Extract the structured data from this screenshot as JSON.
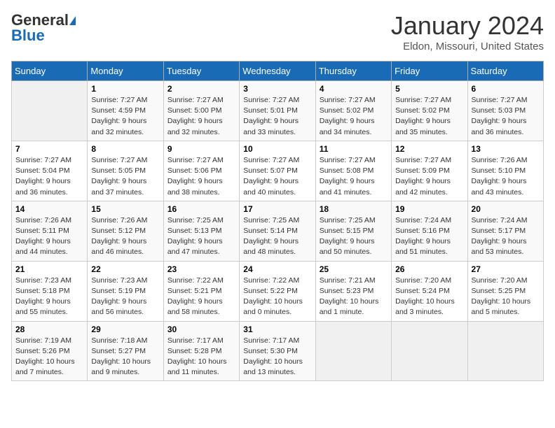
{
  "header": {
    "logo_general": "General",
    "logo_blue": "Blue",
    "month": "January 2024",
    "location": "Eldon, Missouri, United States"
  },
  "days_of_week": [
    "Sunday",
    "Monday",
    "Tuesday",
    "Wednesday",
    "Thursday",
    "Friday",
    "Saturday"
  ],
  "weeks": [
    [
      {
        "day": "",
        "info": ""
      },
      {
        "day": "1",
        "info": "Sunrise: 7:27 AM\nSunset: 4:59 PM\nDaylight: 9 hours\nand 32 minutes."
      },
      {
        "day": "2",
        "info": "Sunrise: 7:27 AM\nSunset: 5:00 PM\nDaylight: 9 hours\nand 32 minutes."
      },
      {
        "day": "3",
        "info": "Sunrise: 7:27 AM\nSunset: 5:01 PM\nDaylight: 9 hours\nand 33 minutes."
      },
      {
        "day": "4",
        "info": "Sunrise: 7:27 AM\nSunset: 5:02 PM\nDaylight: 9 hours\nand 34 minutes."
      },
      {
        "day": "5",
        "info": "Sunrise: 7:27 AM\nSunset: 5:02 PM\nDaylight: 9 hours\nand 35 minutes."
      },
      {
        "day": "6",
        "info": "Sunrise: 7:27 AM\nSunset: 5:03 PM\nDaylight: 9 hours\nand 36 minutes."
      }
    ],
    [
      {
        "day": "7",
        "info": "Sunrise: 7:27 AM\nSunset: 5:04 PM\nDaylight: 9 hours\nand 36 minutes."
      },
      {
        "day": "8",
        "info": "Sunrise: 7:27 AM\nSunset: 5:05 PM\nDaylight: 9 hours\nand 37 minutes."
      },
      {
        "day": "9",
        "info": "Sunrise: 7:27 AM\nSunset: 5:06 PM\nDaylight: 9 hours\nand 38 minutes."
      },
      {
        "day": "10",
        "info": "Sunrise: 7:27 AM\nSunset: 5:07 PM\nDaylight: 9 hours\nand 40 minutes."
      },
      {
        "day": "11",
        "info": "Sunrise: 7:27 AM\nSunset: 5:08 PM\nDaylight: 9 hours\nand 41 minutes."
      },
      {
        "day": "12",
        "info": "Sunrise: 7:27 AM\nSunset: 5:09 PM\nDaylight: 9 hours\nand 42 minutes."
      },
      {
        "day": "13",
        "info": "Sunrise: 7:26 AM\nSunset: 5:10 PM\nDaylight: 9 hours\nand 43 minutes."
      }
    ],
    [
      {
        "day": "14",
        "info": "Sunrise: 7:26 AM\nSunset: 5:11 PM\nDaylight: 9 hours\nand 44 minutes."
      },
      {
        "day": "15",
        "info": "Sunrise: 7:26 AM\nSunset: 5:12 PM\nDaylight: 9 hours\nand 46 minutes."
      },
      {
        "day": "16",
        "info": "Sunrise: 7:25 AM\nSunset: 5:13 PM\nDaylight: 9 hours\nand 47 minutes."
      },
      {
        "day": "17",
        "info": "Sunrise: 7:25 AM\nSunset: 5:14 PM\nDaylight: 9 hours\nand 48 minutes."
      },
      {
        "day": "18",
        "info": "Sunrise: 7:25 AM\nSunset: 5:15 PM\nDaylight: 9 hours\nand 50 minutes."
      },
      {
        "day": "19",
        "info": "Sunrise: 7:24 AM\nSunset: 5:16 PM\nDaylight: 9 hours\nand 51 minutes."
      },
      {
        "day": "20",
        "info": "Sunrise: 7:24 AM\nSunset: 5:17 PM\nDaylight: 9 hours\nand 53 minutes."
      }
    ],
    [
      {
        "day": "21",
        "info": "Sunrise: 7:23 AM\nSunset: 5:18 PM\nDaylight: 9 hours\nand 55 minutes."
      },
      {
        "day": "22",
        "info": "Sunrise: 7:23 AM\nSunset: 5:19 PM\nDaylight: 9 hours\nand 56 minutes."
      },
      {
        "day": "23",
        "info": "Sunrise: 7:22 AM\nSunset: 5:21 PM\nDaylight: 9 hours\nand 58 minutes."
      },
      {
        "day": "24",
        "info": "Sunrise: 7:22 AM\nSunset: 5:22 PM\nDaylight: 10 hours\nand 0 minutes."
      },
      {
        "day": "25",
        "info": "Sunrise: 7:21 AM\nSunset: 5:23 PM\nDaylight: 10 hours\nand 1 minute."
      },
      {
        "day": "26",
        "info": "Sunrise: 7:20 AM\nSunset: 5:24 PM\nDaylight: 10 hours\nand 3 minutes."
      },
      {
        "day": "27",
        "info": "Sunrise: 7:20 AM\nSunset: 5:25 PM\nDaylight: 10 hours\nand 5 minutes."
      }
    ],
    [
      {
        "day": "28",
        "info": "Sunrise: 7:19 AM\nSunset: 5:26 PM\nDaylight: 10 hours\nand 7 minutes."
      },
      {
        "day": "29",
        "info": "Sunrise: 7:18 AM\nSunset: 5:27 PM\nDaylight: 10 hours\nand 9 minutes."
      },
      {
        "day": "30",
        "info": "Sunrise: 7:17 AM\nSunset: 5:28 PM\nDaylight: 10 hours\nand 11 minutes."
      },
      {
        "day": "31",
        "info": "Sunrise: 7:17 AM\nSunset: 5:30 PM\nDaylight: 10 hours\nand 13 minutes."
      },
      {
        "day": "",
        "info": ""
      },
      {
        "day": "",
        "info": ""
      },
      {
        "day": "",
        "info": ""
      }
    ]
  ]
}
